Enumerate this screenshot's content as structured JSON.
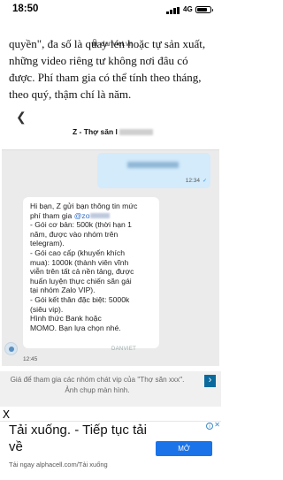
{
  "status_bar": {
    "time": "18:50",
    "network": "4G"
  },
  "browser": {
    "url": "danviet.vn"
  },
  "article": {
    "lines": [
      "quyền\", đa số là quay lén hoặc tự sản xuất,",
      "những video riêng tư không nơi đâu có",
      "được. Phí tham gia có thể tính theo tháng,",
      "theo quý, thậm chí là năm."
    ]
  },
  "chat": {
    "title": "Z - Thợ săn l",
    "outgoing_time": "12:34",
    "incoming": {
      "lines": [
        "Hi bạn, Z gửi bạn thông tin mức",
        "phí tham gia",
        "- Gói cơ bản: 500k (thời hạn 1",
        "năm, được vào nhóm trên",
        "telegram).",
        "- Gói cao cấp (khuyến khích",
        "mua): 1000k (thành viên vĩnh",
        "viễn trên tất cả nền tảng, được",
        "huấn luyện thực chiến săn gái",
        "tại nhóm Zalo VIP).",
        "- Gói kết thân đặc biệt: 5000k",
        "(siêu vip).",
        "    Hình thức Bank hoặc",
        "MOMO.  Bạn lựa chọn nhé."
      ],
      "mention": "@zo",
      "time": "12:45"
    },
    "watermark": "DANVIET"
  },
  "caption": {
    "text": "Giá để tham gia các nhóm chát vip của \"Thợ săn xxx\". Ảnh chụp màn hình."
  },
  "ad": {
    "close": "X",
    "title": "Tải xuống. - Tiếp tục tải về",
    "sub": "Tải ngay alphacell.com/Tải xuống",
    "cta": "MỞ",
    "info": "i",
    "x": "✕"
  }
}
